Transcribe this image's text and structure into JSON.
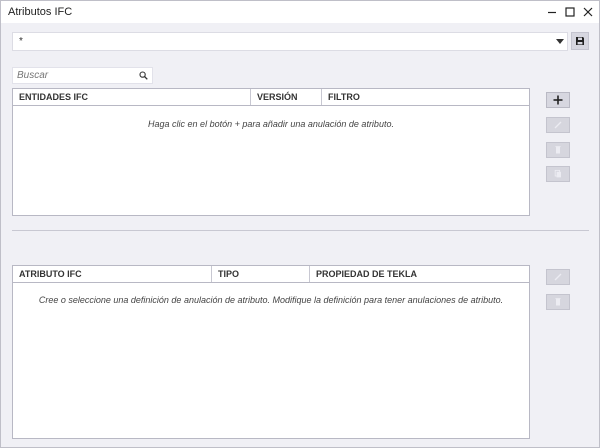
{
  "window": {
    "title": "Atributos IFC"
  },
  "selector": {
    "value": "*"
  },
  "search": {
    "placeholder": "Buscar",
    "value": ""
  },
  "entities_table": {
    "columns": [
      "ENTIDADES IFC",
      "VERSIÓN",
      "FILTRO"
    ],
    "rows": [],
    "empty_message": "Haga clic en el botón + para añadir una anulación de atributo."
  },
  "attributes_table": {
    "columns": [
      "ATRIBUTO IFC",
      "TIPO",
      "PROPIEDAD DE TEKLA"
    ],
    "rows": [],
    "empty_message": "Cree o seleccione una definición de anulación de atributo. Modifique la definición para tener anulaciones de atributo."
  },
  "icons": {
    "minimize": "minimize-icon",
    "maximize": "maximize-icon",
    "close": "close-icon",
    "save": "floppy-disk-icon",
    "search": "magnifier-icon",
    "add": "plus-icon",
    "edit": "pencil-icon",
    "delete": "trash-icon",
    "copy": "copy-icon"
  },
  "colors": {
    "background": "#f0f0f5",
    "panel": "#ffffff",
    "button": "#d7d7e0",
    "border": "#b8b8c4"
  }
}
